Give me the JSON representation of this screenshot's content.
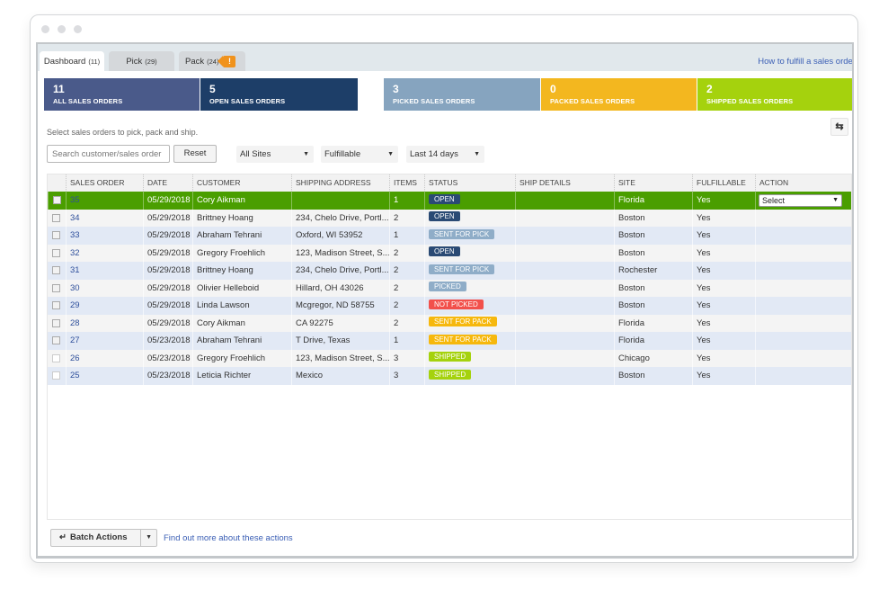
{
  "tabs": [
    {
      "label": "Dashboard",
      "count": "(11)",
      "active": true
    },
    {
      "label": "Pick",
      "count": "(29)",
      "active": false
    },
    {
      "label": "Pack",
      "count": "(24)",
      "active": false,
      "alert": "!"
    }
  ],
  "help_link": "How to fulfill a sales order",
  "summary": [
    {
      "value": "11",
      "label": "ALL SALES ORDERS",
      "color": "#4a5a8a"
    },
    {
      "value": "5",
      "label": "OPEN SALES ORDERS",
      "color": "#1d3e68"
    },
    {
      "value": "3",
      "label": "PICKED SALES ORDERS",
      "color": "#86a4bf"
    },
    {
      "value": "0",
      "label": "PACKED SALES ORDERS",
      "color": "#f3b71f"
    },
    {
      "value": "2",
      "label": "SHIPPED SALES ORDERS",
      "color": "#a5d20d"
    }
  ],
  "instructions": "Select sales orders to pick, pack and ship.",
  "refresh_icon": "refresh-arrows-icon",
  "filters": {
    "search_placeholder": "Search customer/sales order",
    "reset_label": "Reset",
    "site": "All Sites",
    "fulfillable": "Fulfillable",
    "date_range": "Last 14 days"
  },
  "table": {
    "columns": [
      "",
      "SALES ORDER",
      "DATE",
      "CUSTOMER",
      "SHIPPING ADDRESS",
      "ITEMS",
      "STATUS",
      "SHIP DETAILS",
      "SITE",
      "FULFILLABLE",
      "ACTION"
    ],
    "rows": [
      {
        "so": "35",
        "date": "05/29/2018",
        "customer": "Cory Aikman",
        "address": "",
        "items": "1",
        "status": "OPEN",
        "ship": "",
        "site": "Florida",
        "fulfillable": "Yes",
        "action": "Select",
        "selected": true
      },
      {
        "so": "34",
        "date": "05/29/2018",
        "customer": "Brittney Hoang",
        "address": "234, Chelo Drive, Portl...",
        "items": "2",
        "status": "OPEN",
        "ship": "",
        "site": "Boston",
        "fulfillable": "Yes",
        "action": ""
      },
      {
        "so": "33",
        "date": "05/29/2018",
        "customer": "Abraham Tehrani",
        "address": "Oxford, WI 53952",
        "items": "1",
        "status": "SENT FOR PICK",
        "ship": "",
        "site": "Boston",
        "fulfillable": "Yes",
        "action": ""
      },
      {
        "so": "32",
        "date": "05/29/2018",
        "customer": "Gregory Froehlich",
        "address": "123, Madison Street, S...",
        "items": "2",
        "status": "OPEN",
        "ship": "",
        "site": "Boston",
        "fulfillable": "Yes",
        "action": ""
      },
      {
        "so": "31",
        "date": "05/29/2018",
        "customer": "Brittney Hoang",
        "address": "234, Chelo Drive, Portl...",
        "items": "2",
        "status": "SENT FOR PICK",
        "ship": "",
        "site": "Rochester",
        "fulfillable": "Yes",
        "action": ""
      },
      {
        "so": "30",
        "date": "05/29/2018",
        "customer": "Olivier Helleboid",
        "address": "Hillard, OH 43026",
        "items": "2",
        "status": "PICKED",
        "ship": "",
        "site": "Boston",
        "fulfillable": "Yes",
        "action": ""
      },
      {
        "so": "29",
        "date": "05/29/2018",
        "customer": "Linda Lawson",
        "address": "Mcgregor, ND 58755",
        "items": "2",
        "status": "NOT PICKED",
        "ship": "",
        "site": "Boston",
        "fulfillable": "Yes",
        "action": ""
      },
      {
        "so": "28",
        "date": "05/29/2018",
        "customer": "Cory Aikman",
        "address": "CA 92275",
        "items": "2",
        "status": "SENT FOR PACK",
        "ship": "",
        "site": "Florida",
        "fulfillable": "Yes",
        "action": ""
      },
      {
        "so": "27",
        "date": "05/23/2018",
        "customer": "Abraham Tehrani",
        "address": "T Drive, Texas",
        "items": "1",
        "status": "SENT FOR PACK",
        "ship": "",
        "site": "Florida",
        "fulfillable": "Yes",
        "action": ""
      },
      {
        "so": "26",
        "date": "05/23/2018",
        "customer": "Gregory Froehlich",
        "address": "123, Madison Street, S...",
        "items": "3",
        "status": "SHIPPED",
        "ship": "",
        "site": "Chicago",
        "fulfillable": "Yes",
        "action": ""
      },
      {
        "so": "25",
        "date": "05/23/2018",
        "customer": "Leticia Richter",
        "address": "Mexico",
        "items": "3",
        "status": "SHIPPED",
        "ship": "",
        "site": "Boston",
        "fulfillable": "Yes",
        "action": ""
      }
    ]
  },
  "status_colors": {
    "OPEN": "#2a4a74",
    "SENT FOR PICK": "#8fadc8",
    "PICKED": "#8fadc8",
    "NOT PICKED": "#f2504b",
    "SENT FOR PACK": "#f6b80d",
    "SHIPPED": "#a5d20d"
  },
  "footer": {
    "batch_icon": "t-arrow-icon",
    "batch_label": "Batch Actions",
    "batch_link": "Find out more about these actions"
  }
}
